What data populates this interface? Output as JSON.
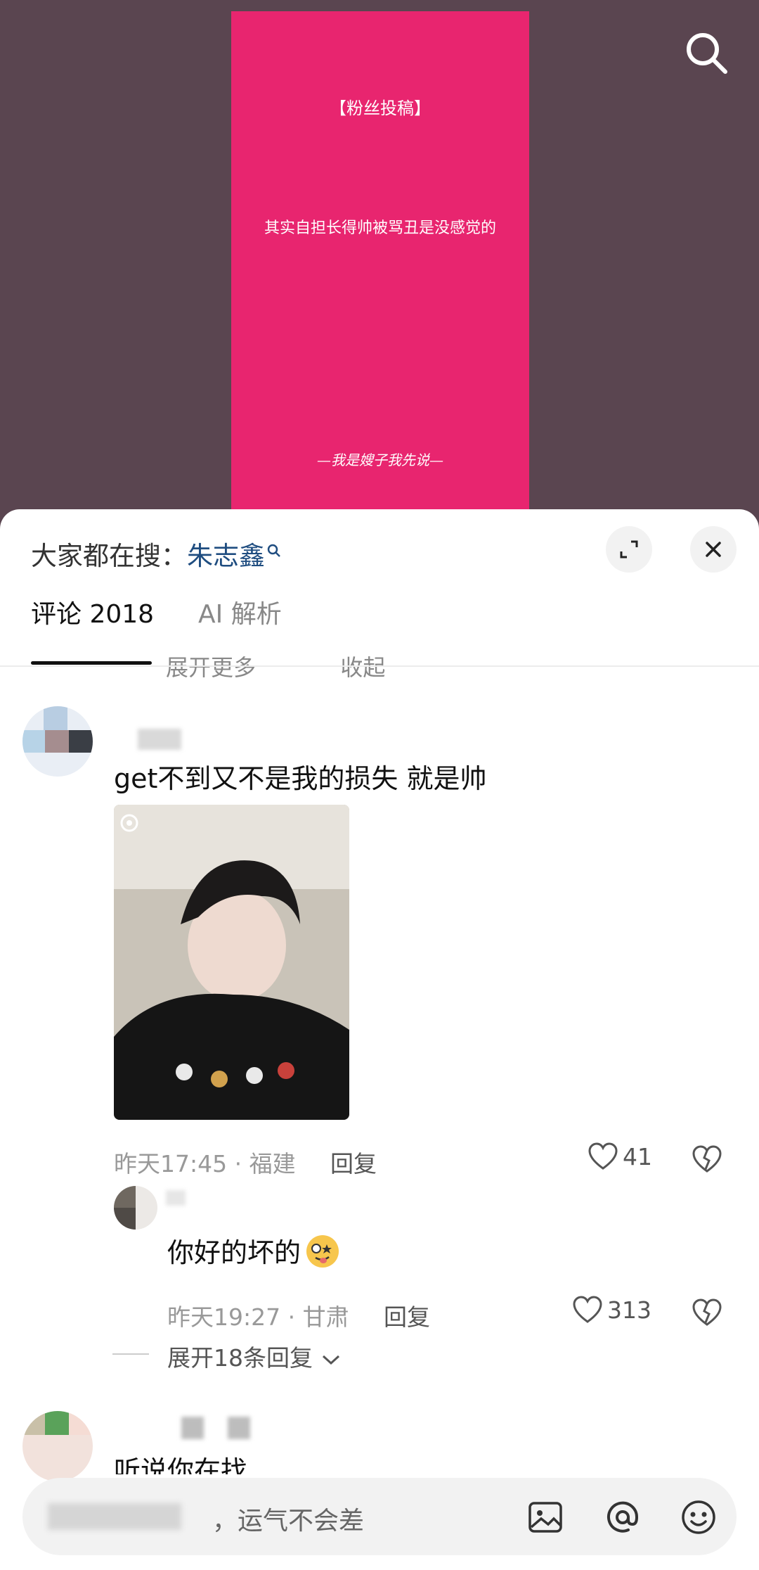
{
  "poster": {
    "tag": "【粉丝投稿】",
    "quote": "其实自担长得帅被骂丑是没感觉的",
    "signature": "—我是嫂子我先说—"
  },
  "header": {
    "hot_prefix": "大家都在搜：",
    "hot_term": "朱志鑫"
  },
  "tabs": [
    {
      "label": "评论 2018"
    },
    {
      "label": "AI 解析"
    }
  ],
  "partial_row": {
    "expand": "展开更多",
    "collapse": "收起"
  },
  "comment1": {
    "text": "get不到又不是我的损失 就是帅",
    "time": "昨天17:45 · 福建",
    "reply": "回复",
    "likes": "41"
  },
  "reply1": {
    "text": "你好的坏的",
    "time": "昨天19:27 · 甘肃",
    "reply": "回复",
    "likes": "313"
  },
  "expand_replies": "展开18条回复",
  "comment2": {
    "text": "听说你在找"
  },
  "input": {
    "placeholder": "，运气不会差"
  },
  "colors": {
    "poster_bg": "#e8256f",
    "video_bg": "#5a4550",
    "hot_term": "#1f4d80"
  }
}
